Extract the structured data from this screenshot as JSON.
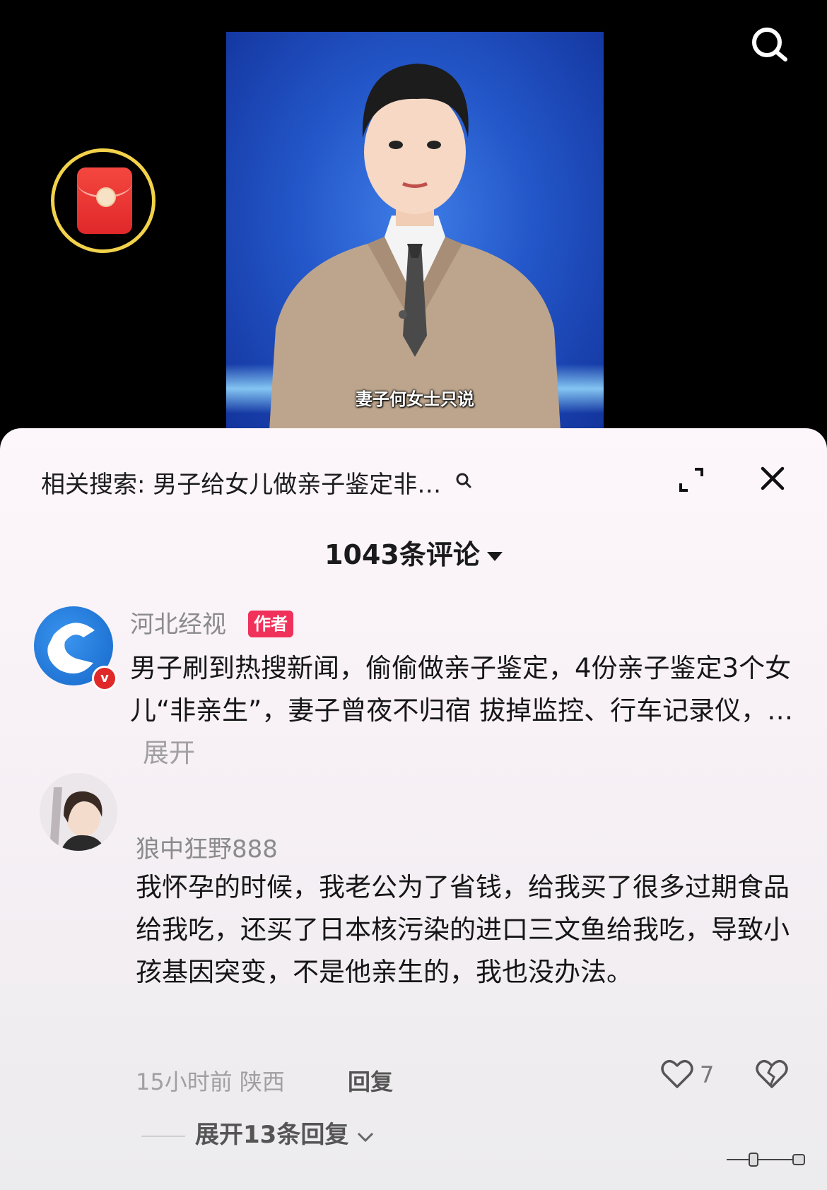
{
  "video": {
    "caption": "妻子何女士只说",
    "icons": {
      "search": "search-icon",
      "red_packet": "red-packet-icon"
    }
  },
  "sheet": {
    "related_search": {
      "label": "相关搜索:",
      "query": "男子给女儿做亲子鉴定非…"
    },
    "comment_count": "1043条评论",
    "icons": {
      "expand": "expand-icon",
      "close": "close-icon",
      "sort": "caret-down-icon"
    }
  },
  "comments": [
    {
      "user": "河北经视",
      "tag": "作者",
      "text": "男子刷到热搜新闻，偷偷做亲子鉴定，4份亲子鉴定3个女儿“非亲生”，妻子曾夜不归宿 拔掉监控、行车记录仪，…",
      "more_label": "展开",
      "verified_badge": "v"
    },
    {
      "user": "狼中狂野888",
      "text": "我怀孕的时候，我老公为了省钱，给我买了很多过期食品给我吃，还买了日本核污染的进口三文鱼给我吃，导致小孩基因突变，不是他亲生的，我也没办法。",
      "meta": "15小时前 陕西",
      "reply_label": "回复",
      "likes": "7",
      "expand_replies": "展开13条回复"
    }
  ],
  "colors": {
    "author_tag": "#f0315a",
    "badge_red": "#e02a2a",
    "red_packet_ring": "#f2d24a"
  }
}
